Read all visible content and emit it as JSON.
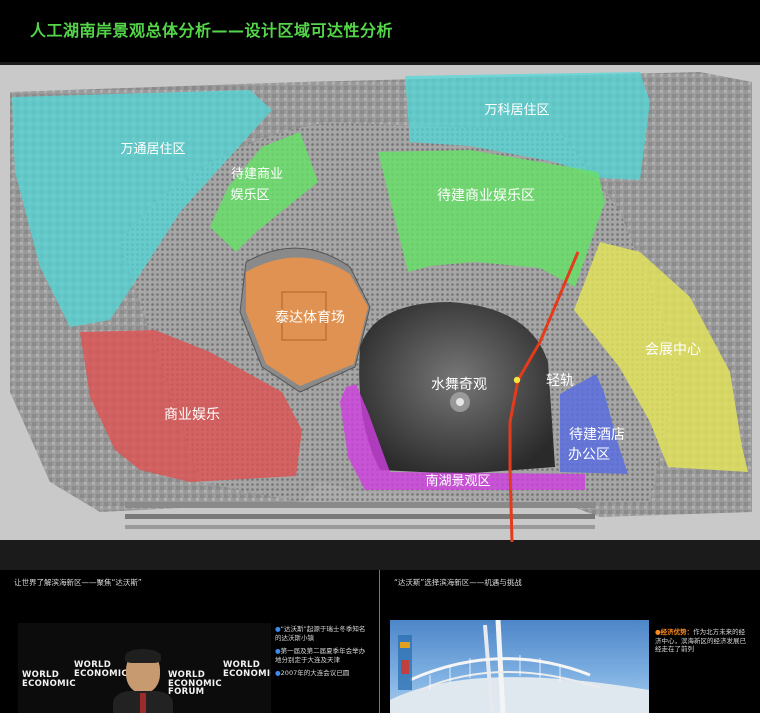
{
  "header": {
    "title": "人工湖南岸景观总体分析——设计区域可达性分析"
  },
  "map": {
    "zones": {
      "wantong": "万通居住区",
      "wanke": "万科居住区",
      "pending_commercial_small_line1": "待建商业",
      "pending_commercial_small_line2": "娱乐区",
      "pending_commercial_large": "待建商业娱乐区",
      "stadium": "泰达体育场",
      "fountain": "水舞奇观",
      "light_rail": "轻轨",
      "convention": "会展中心",
      "commercial": "商业娱乐",
      "hotel_line1": "待建酒店",
      "hotel_line2": "办公区",
      "south_lake": "南湖景观区"
    },
    "colors": {
      "cyan": "#4fd9d9",
      "green": "#66e066",
      "orange": "#e8924a",
      "yellow": "#e4e45a",
      "red": "#e05050",
      "blue": "#5a6ee0",
      "magenta": "#d040e0",
      "rail": "#e43b1b"
    }
  },
  "left_panel": {
    "heading": "让世界了解滨海新区——聚焦“达沃斯”",
    "bullets": [
      "“达沃斯”起源于瑞士冬季知名的达沃斯小镇",
      "第一届及第二届夏季年会举办地分别定于大连及天津",
      "2007年的大连会议已圆"
    ],
    "logo_lines": [
      "WORLD",
      "ECONOMIC",
      "FORUM"
    ]
  },
  "right_panel": {
    "heading": "“达沃斯”选择滨海新区——机遇与挑战",
    "highlight": "经济优势：",
    "text": "作为北方未来的经济中心，滨海新区的经济发展已经走在了前列"
  }
}
